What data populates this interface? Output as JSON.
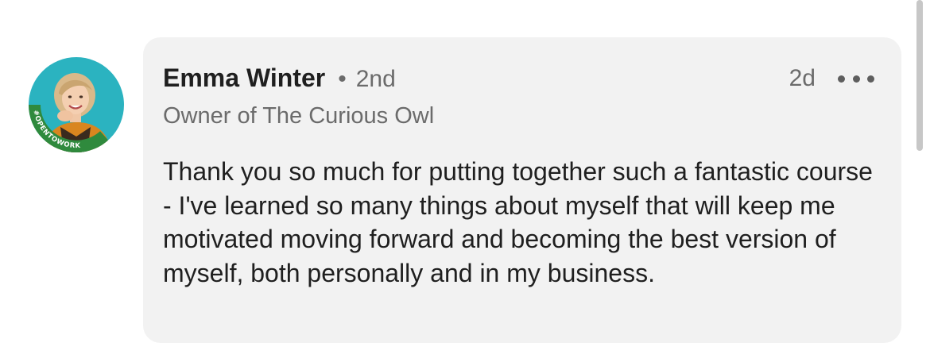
{
  "comment": {
    "author": {
      "name": "Emma Winter",
      "separator": "•",
      "degree": "2nd",
      "headline": "Owner of The Curious Owl",
      "avatar_badge": "#OPENTOWORK"
    },
    "timestamp": "2d",
    "more_icon": "ellipsis-icon",
    "text": "Thank you so much for putting together such a fantastic course - I've learned so many things about myself that will keep me motivated moving forward and becoming the best version of myself, both personally and in my business."
  },
  "colors": {
    "bubble_bg": "#f2f2f2",
    "open_to_work_ring": "#2f8a3d",
    "avatar_bg": "#2bb3c0"
  }
}
